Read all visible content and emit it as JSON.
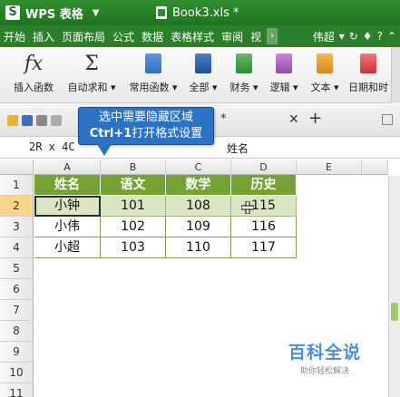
{
  "app": {
    "name": "WPS 表格",
    "document": "Book3.xls *"
  },
  "menu": [
    "开始",
    "插入",
    "页面布局",
    "公式",
    "数据",
    "表格样式",
    "审阅",
    "视"
  ],
  "menu_right": {
    "user": "伟超"
  },
  "ribbon": {
    "items": [
      {
        "label": "插入函数",
        "icon": "fx-icon"
      },
      {
        "label": "自动求和",
        "icon": "sigma-icon"
      },
      {
        "label": "常用函数",
        "icon": "book-blue-icon"
      },
      {
        "label": "全部",
        "icon": "book-navy-icon"
      },
      {
        "label": "财务",
        "icon": "book-green-icon"
      },
      {
        "label": "逻辑",
        "icon": "book-purple-icon"
      },
      {
        "label": "文本",
        "icon": "book-orange-icon"
      },
      {
        "label": "日期和时",
        "icon": "book-red-icon"
      }
    ]
  },
  "formula_bar": {
    "namebox": "2R x 4C",
    "content": "姓名"
  },
  "tooltip": {
    "line1": "选中需要隐藏区域",
    "line2_bold": "Ctrl+1",
    "line2_rest": "打开格式设置"
  },
  "columns": [
    "A",
    "B",
    "C",
    "D",
    "E"
  ],
  "rows": [
    "1",
    "2",
    "3",
    "4",
    "5",
    "6",
    "7",
    "8",
    "9",
    "10",
    "11"
  ],
  "table": {
    "header": [
      "姓名",
      "语文",
      "数学",
      "历史"
    ],
    "rows": [
      [
        "小钟",
        "101",
        "108",
        "115"
      ],
      [
        "小伟",
        "102",
        "109",
        "116"
      ],
      [
        "小超",
        "103",
        "110",
        "117"
      ]
    ]
  },
  "watermark": {
    "title": "百科全说",
    "subtitle": "助你轻松解决"
  },
  "colors": {
    "titlebar": "#1f741f",
    "header_fill": "#75a332",
    "selection_row": "#d8e6c2",
    "tooltip": "#2a72c4"
  }
}
